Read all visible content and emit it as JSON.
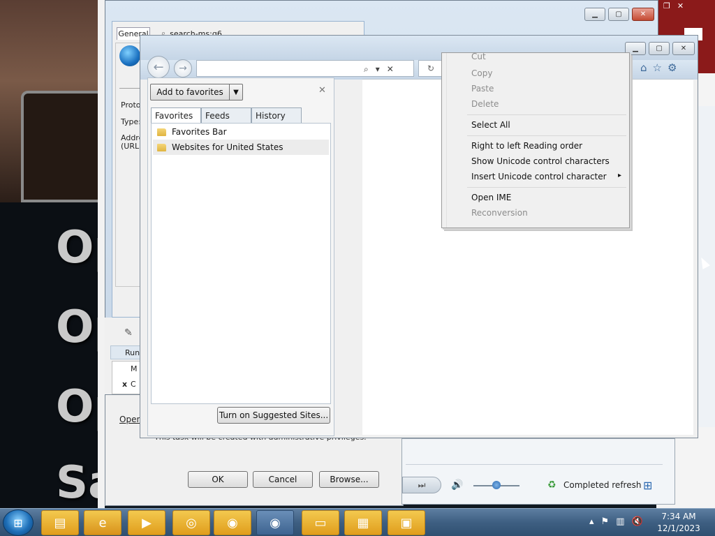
{
  "properties_window": {
    "tab_general": "General",
    "address_bar": "search-ms:q6",
    "protocol_label": "Proto",
    "type_label": "Type:",
    "address_label": "Addre",
    "url_label": "(URL)"
  },
  "run_dialog": {
    "title_fragment": "Run",
    "open_label": "Open",
    "admin_note": "This task will be created with administrative privileges.",
    "ok_button": "OK",
    "cancel_button": "Cancel",
    "browse_button": "Browse...",
    "col_mark": "x",
    "col_m": "M",
    "col_c": "C"
  },
  "media_player": {
    "status_text": "Completed refresh"
  },
  "ie": {
    "favorites_panel": {
      "add_button": "Add to favorites",
      "tabs": [
        "Favorites",
        "Feeds",
        "History"
      ],
      "items": [
        "Favorites Bar",
        "Websites for United States"
      ],
      "suggested_button": "Turn on Suggested Sites..."
    }
  },
  "context_menu": {
    "items_top": [
      {
        "label": "Cut",
        "enabled": false
      },
      {
        "label": "Copy",
        "enabled": false
      },
      {
        "label": "Paste",
        "enabled": false
      },
      {
        "label": "Delete",
        "enabled": false
      }
    ],
    "select_all": "Select All",
    "items_mid": [
      {
        "label": "Right to left Reading order",
        "enabled": true
      },
      {
        "label": "Show Unicode control characters",
        "enabled": true
      },
      {
        "label": "Insert Unicode control character",
        "enabled": true,
        "submenu": true
      }
    ],
    "items_bottom": [
      {
        "label": "Open IME",
        "enabled": true
      },
      {
        "label": "Reconversion",
        "enabled": false
      }
    ],
    "submenu_arrow": "▸"
  },
  "background": {
    "zoomed_text": [
      "Op",
      "Op",
      "Op",
      "Sa"
    ]
  },
  "taskbar": {
    "apps": [
      "file-explorer-icon",
      "internet-explorer-icon",
      "media-player-icon",
      "chrome-icon",
      "firefox-icon",
      "firefox-alt-icon",
      "remote-desktop-icon",
      "calculator-icon",
      "control-panel-icon"
    ],
    "clock_time": "7:34 AM",
    "clock_date": "12/1/2023"
  }
}
